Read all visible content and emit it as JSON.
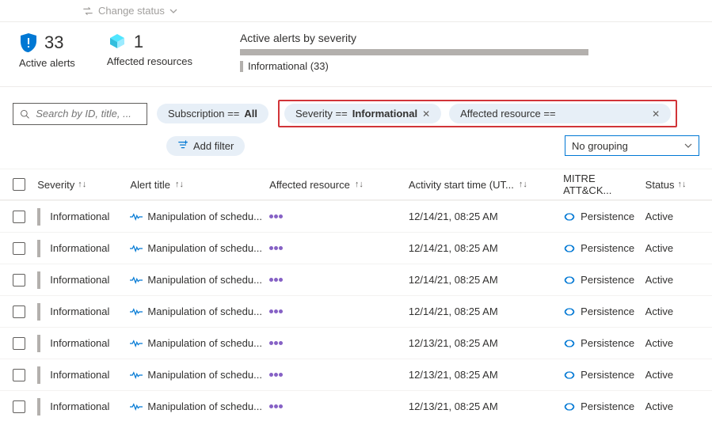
{
  "topbar": {
    "change_status": "Change status"
  },
  "summary": {
    "active_alerts_count": "33",
    "active_alerts_label": "Active alerts",
    "affected_resources_count": "1",
    "affected_resources_label": "Affected resources",
    "severity_title": "Active alerts by severity",
    "severity_caption": "Informational (33)"
  },
  "search": {
    "placeholder": "Search by ID, title, ..."
  },
  "filters": {
    "subscription_key": "Subscription == ",
    "subscription_val": "All",
    "severity_key": "Severity == ",
    "severity_val": "Informational",
    "affected_key": "Affected resource ==",
    "add_filter": "Add filter",
    "grouping": "No grouping"
  },
  "columns": {
    "severity": "Severity",
    "title": "Alert title",
    "resource": "Affected resource",
    "time": "Activity start time (UT...",
    "mitre": "MITRE ATT&CK...",
    "status": "Status"
  },
  "rows": [
    {
      "severity": "Informational",
      "title": "Manipulation of schedu...",
      "time": "12/14/21, 08:25 AM",
      "mitre": "Persistence",
      "status": "Active"
    },
    {
      "severity": "Informational",
      "title": "Manipulation of schedu...",
      "time": "12/14/21, 08:25 AM",
      "mitre": "Persistence",
      "status": "Active"
    },
    {
      "severity": "Informational",
      "title": "Manipulation of schedu...",
      "time": "12/14/21, 08:25 AM",
      "mitre": "Persistence",
      "status": "Active"
    },
    {
      "severity": "Informational",
      "title": "Manipulation of schedu...",
      "time": "12/14/21, 08:25 AM",
      "mitre": "Persistence",
      "status": "Active"
    },
    {
      "severity": "Informational",
      "title": "Manipulation of schedu...",
      "time": "12/13/21, 08:25 AM",
      "mitre": "Persistence",
      "status": "Active"
    },
    {
      "severity": "Informational",
      "title": "Manipulation of schedu...",
      "time": "12/13/21, 08:25 AM",
      "mitre": "Persistence",
      "status": "Active"
    },
    {
      "severity": "Informational",
      "title": "Manipulation of schedu...",
      "time": "12/13/21, 08:25 AM",
      "mitre": "Persistence",
      "status": "Active"
    }
  ]
}
